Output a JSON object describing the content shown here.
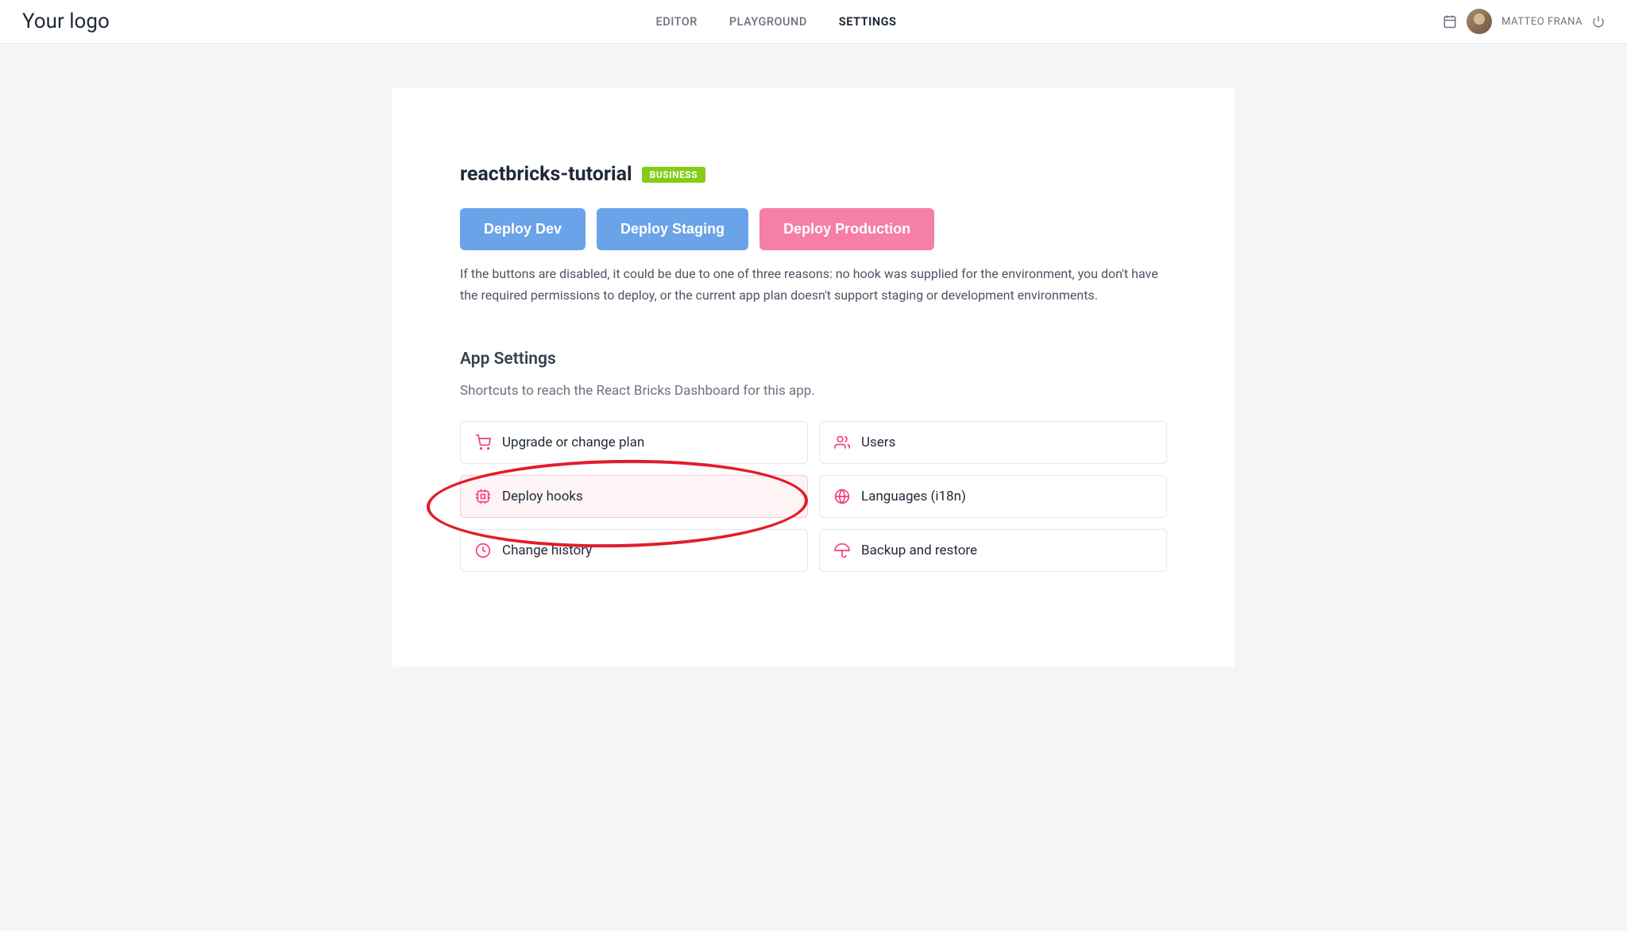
{
  "header": {
    "logo": "Your logo",
    "nav": {
      "editor": "EDITOR",
      "playground": "PLAYGROUND",
      "settings": "SETTINGS"
    },
    "user_name": "MATTEO FRANA"
  },
  "page": {
    "title": "reactbricks-tutorial",
    "badge": "BUSINESS",
    "deploy_buttons": {
      "dev": "Deploy Dev",
      "staging": "Deploy Staging",
      "production": "Deploy Production"
    },
    "info_text": "If the buttons are disabled, it could be due to one of three reasons: no hook was supplied for the environment, you don't have the required permissions to deploy, or the current app plan doesn't support staging or development environments.",
    "section_title": "App Settings",
    "section_subtitle": "Shortcuts to reach the React Bricks Dashboard for this app.",
    "items": {
      "upgrade": "Upgrade or change plan",
      "users": "Users",
      "deploy_hooks": "Deploy hooks",
      "languages": "Languages (i18n)",
      "change_history": "Change history",
      "backup": "Backup and restore"
    }
  }
}
